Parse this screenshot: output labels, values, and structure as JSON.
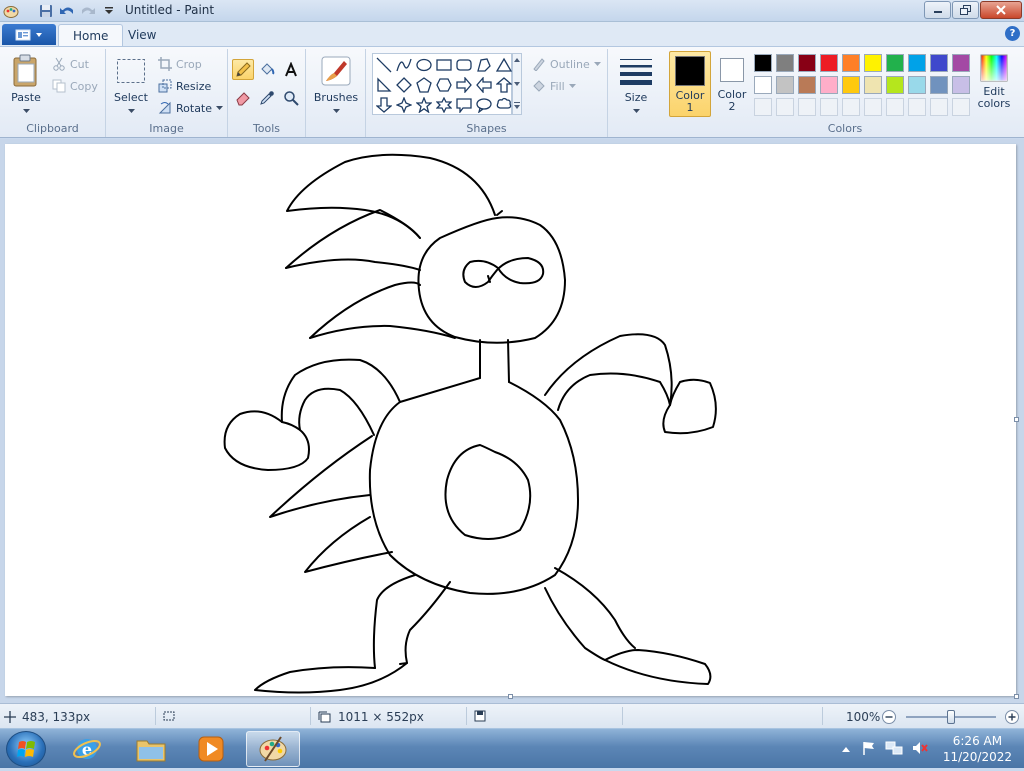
{
  "window": {
    "title": "Untitled - Paint"
  },
  "tabs": {
    "home": "Home",
    "view": "View"
  },
  "help": "?",
  "clipboard": {
    "label": "Clipboard",
    "paste": "Paste",
    "cut": "Cut",
    "copy": "Copy"
  },
  "image": {
    "label": "Image",
    "select": "Select",
    "crop": "Crop",
    "resize": "Resize",
    "rotate": "Rotate"
  },
  "tools": {
    "label": "Tools"
  },
  "brushes": {
    "label": "Brushes"
  },
  "shapes": {
    "label": "Shapes",
    "outline": "Outline",
    "fill": "Fill"
  },
  "size": {
    "label": "Size"
  },
  "colors": {
    "label": "Colors",
    "color1_line1": "Color",
    "color1_line2": "1",
    "color2_line1": "Color",
    "color2_line2": "2",
    "edit_line1": "Edit",
    "edit_line2": "colors",
    "color1_value": "#000000",
    "color2_value": "#ffffff",
    "palette_row1": [
      "#000000",
      "#7f7f7f",
      "#880015",
      "#ed1c24",
      "#ff7f27",
      "#fff200",
      "#22b14c",
      "#00a2e8",
      "#3f48cc",
      "#a349a4"
    ],
    "palette_row2": [
      "#ffffff",
      "#c3c3c3",
      "#b97a57",
      "#ffaec9",
      "#ffc90e",
      "#efe4b0",
      "#b5e61d",
      "#99d9ea",
      "#7092be",
      "#c8bfe7"
    ]
  },
  "status": {
    "cursor_pos": "483, 133px",
    "canvas_size": "1011 × 552px",
    "zoom": "100%",
    "zoom_slider_fraction": 0.5
  },
  "taskbar": {
    "time": "6:26 AM",
    "date": "11/20/2022"
  }
}
